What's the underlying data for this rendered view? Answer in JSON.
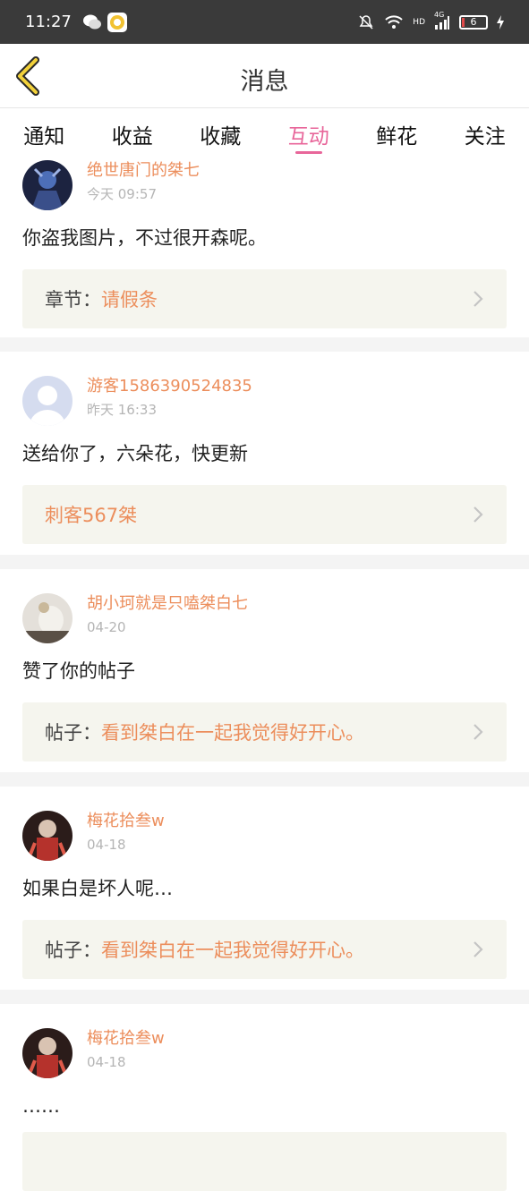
{
  "status_bar": {
    "time": "11:27",
    "network": "4G",
    "hd": "HD",
    "battery": "6"
  },
  "header": {
    "title": "消息"
  },
  "tabs": [
    {
      "label": "通知"
    },
    {
      "label": "收益"
    },
    {
      "label": "收藏"
    },
    {
      "label": "互动",
      "active": true
    },
    {
      "label": "鲜花"
    },
    {
      "label": "关注"
    }
  ],
  "items": [
    {
      "user": "绝世唐门的桀七",
      "time": "今天 09:57",
      "message": "你盗我图片，不过很开森呢。",
      "ref_prefix": "章节：",
      "ref_text": "请假条"
    },
    {
      "user": "游客1586390524835",
      "time": "昨天 16:33",
      "message": "送给你了，六朵花，快更新",
      "ref_prefix": "",
      "ref_text": "刺客567桀"
    },
    {
      "user": "胡小珂就是只嗑桀白七",
      "time": "04-20",
      "message": "赞了你的帖子",
      "ref_prefix": "帖子：",
      "ref_text": "看到桀白在一起我觉得好开心。"
    },
    {
      "user": "梅花拾叁w",
      "time": "04-18",
      "message": "如果白是坏人呢…",
      "ref_prefix": "帖子：",
      "ref_text": "看到桀白在一起我觉得好开心。"
    },
    {
      "user": "梅花拾叁w",
      "time": "04-18",
      "message": "……"
    }
  ],
  "colors": {
    "accent": "#e8669a",
    "username": "#ec8e5c",
    "ref_bg": "#f5f5ee"
  }
}
